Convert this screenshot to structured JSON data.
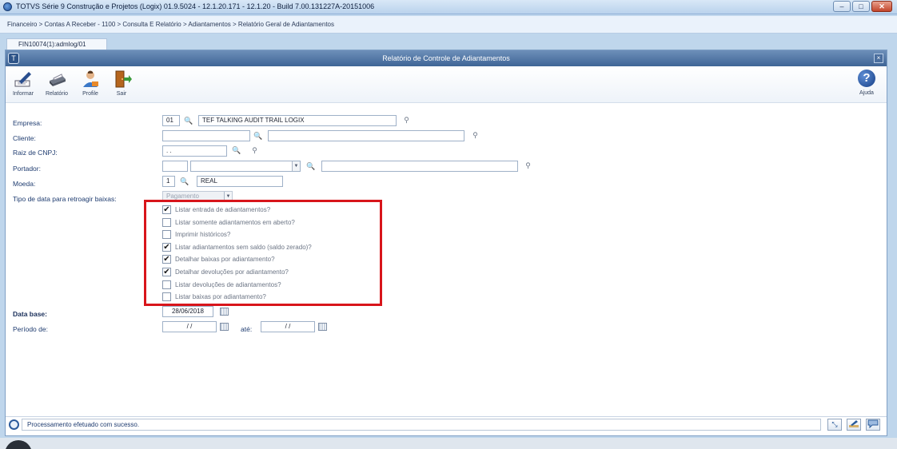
{
  "titlebar": {
    "title": "TOTVS Série 9 Construção e Projetos (Logix) 01.9.5024  -  12.1.20.171 - 12.1.20 - Build 7.00.131227A-20151006",
    "min": "‒",
    "max": "□",
    "close": "✕"
  },
  "breadcrumb": "Financeiro > Contas A Receber - 1100 > Consulta E Relatório > Adiantamentos > Relatório Geral de Adiantamentos",
  "tab_label": "FIN10074(1):admlog/01",
  "window": {
    "title": "Relatório de Controle de Adiantamentos",
    "close": "×",
    "logo": "T"
  },
  "toolbar": {
    "informar": "Informar",
    "relatorio": "Relatório",
    "profile": "Profile",
    "sair": "Sair",
    "ajuda": "Ajuda",
    "help_glyph": "?"
  },
  "form": {
    "empresa_label": "Empresa:",
    "empresa_code": "01",
    "empresa_name": "TEF TALKING AUDIT TRAIL LOGIX",
    "cliente_label": "Cliente:",
    "cliente_code": "",
    "cliente_name": "",
    "raiz_label": "Raiz de CNPJ:",
    "raiz_value": " .  .",
    "portador_label": "Portador:",
    "portador_code": "",
    "portador_type": "",
    "portador_name": "",
    "moeda_label": "Moeda:",
    "moeda_code": "1",
    "moeda_name": "REAL",
    "tipo_label": "Tipo de data para retroagir baixas:",
    "tipo_value": "Pagamento",
    "data_base_label": "Data base:",
    "data_base_value": "28/06/2018",
    "periodo_label": "Período de:",
    "periodo_de": "/ /",
    "ate_label": "até:",
    "periodo_ate": "/ /"
  },
  "checkboxes": [
    {
      "label": "Listar entrada de adiantamentos?",
      "checked": true
    },
    {
      "label": "Listar somente adiantamentos em aberto?",
      "checked": false
    },
    {
      "label": "Imprimir históricos?",
      "checked": false
    },
    {
      "label": "Listar adiantamentos sem saldo (saldo zerado)?",
      "checked": true
    },
    {
      "label": "Detalhar baixas por adiantamento?",
      "checked": true
    },
    {
      "label": "Detalhar devoluções por adiantamento?",
      "checked": true
    },
    {
      "label": "Listar devoluções de adiantamentos?",
      "checked": false
    },
    {
      "label": "Listar baixas por adiantamento?",
      "checked": false
    }
  ],
  "check_glyph": "✔",
  "status": {
    "message": "Processamento efetuado com sucesso."
  },
  "icons": {
    "zoom": "🔍",
    "filter": "⚲",
    "arrow": "▼",
    "resize": "⤡",
    "chat": "💬"
  },
  "colors": {
    "highlight": "#d8151b",
    "header": "#3f6596"
  }
}
